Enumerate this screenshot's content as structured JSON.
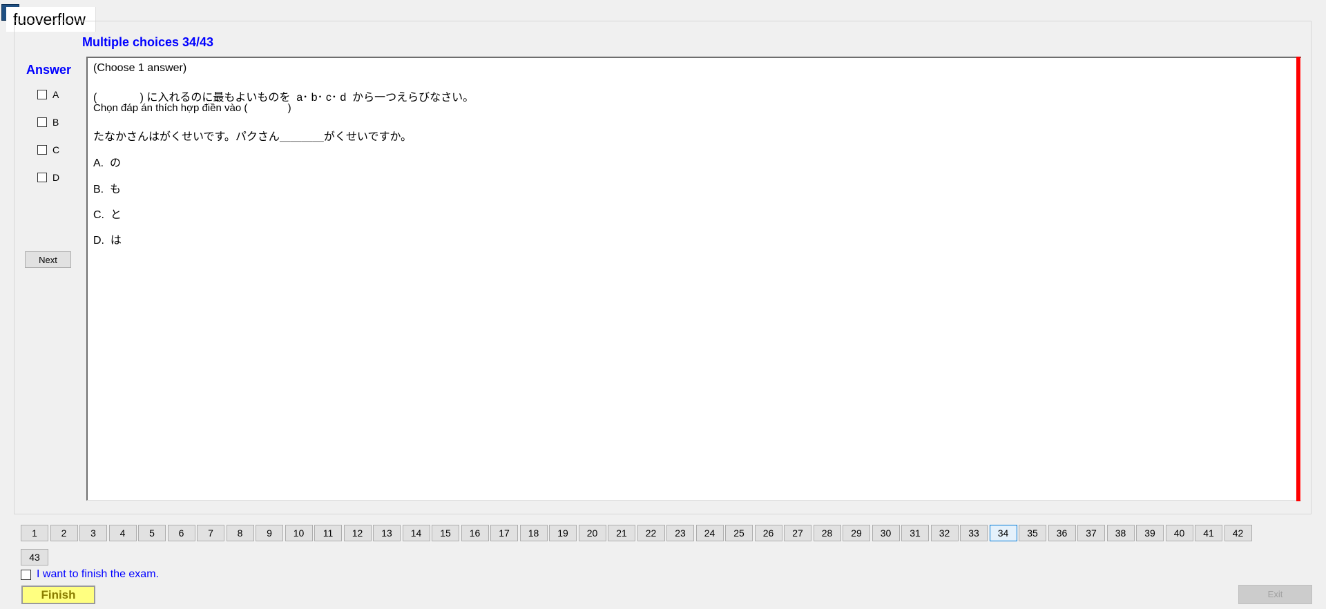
{
  "window": {
    "title": "fuoverflow"
  },
  "section": {
    "title": "Multiple choices 34/43"
  },
  "answer_panel": {
    "label": "Answer",
    "choices": [
      "A",
      "B",
      "C",
      "D"
    ],
    "next_label": "Next"
  },
  "question": {
    "instruction": "(Choose 1 answer)",
    "line1": "(              ) に入れるのに最もよいものを  a･ b･ c･ d  から一つえらびなさい。",
    "line2": "Chọn đáp án thích hợp điền vào (              )",
    "sentence": "たなかさんはがくせいです。パクさん＿＿＿＿がくせいですか。",
    "options": [
      "A.  の",
      "B.  も",
      "C.  と",
      "D.  は"
    ]
  },
  "navigation": {
    "row1": [
      "1",
      "2",
      "3",
      "4",
      "5",
      "6",
      "7",
      "8",
      "9",
      "10",
      "11",
      "12",
      "13",
      "14",
      "15",
      "16",
      "17",
      "18",
      "19",
      "20",
      "21",
      "22",
      "23",
      "24",
      "25",
      "26",
      "27",
      "28",
      "29",
      "30",
      "31",
      "32",
      "33",
      "34",
      "35",
      "36",
      "37",
      "38",
      "39",
      "40",
      "41",
      "42"
    ],
    "row2": [
      "43"
    ],
    "current": "34"
  },
  "footer": {
    "finish_check_label": "I want to finish the exam.",
    "finish_label": "Finish",
    "exit_label": "Exit"
  },
  "colors": {
    "accent_blue": "#0000ff",
    "scrollbar_red": "#ff0000",
    "finish_yellow": "#ffff80"
  }
}
